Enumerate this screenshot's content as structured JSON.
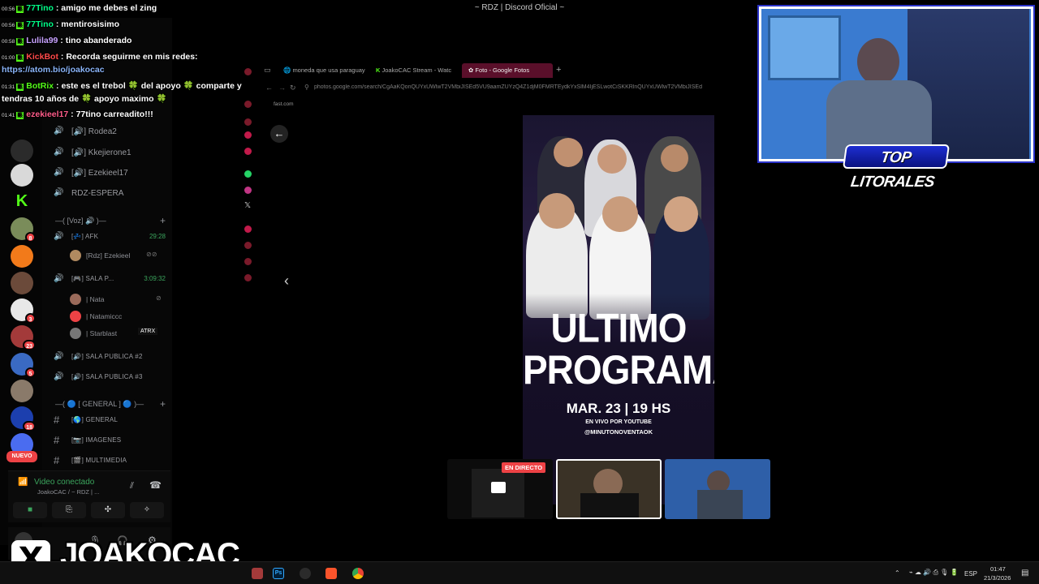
{
  "window": {
    "title": "~ RDZ | Discord Oficial ~"
  },
  "chat": [
    {
      "time": "00:56",
      "user": "77Tino",
      "color": "#00ff88",
      "sep": " : ",
      "text": "amigo me debes el zing"
    },
    {
      "time": "00:56",
      "user": "77Tino",
      "color": "#00ff88",
      "sep": " : ",
      "text": "mentirosisimo"
    },
    {
      "time": "00:58",
      "user": "Lulila99",
      "color": "#c8a2ff",
      "sep": " : ",
      "text": "tino abanderado"
    },
    {
      "time": "01:00",
      "user": "KickBot",
      "color": "#ff4a4a",
      "sep": " : ",
      "text": "Recorda seguirme en mis redes:"
    },
    {
      "time": "",
      "user": "",
      "color": "#ffffff",
      "sep": "",
      "text": "https://atom.bio/joakocac",
      "link": true
    },
    {
      "time": "01:31",
      "user": "BotRix",
      "color": "#53fc18",
      "sep": " : ",
      "text": "este es el trebol 🍀 del apoyo 🍀 comparte y"
    },
    {
      "time": "",
      "user": "",
      "color": "#ffffff",
      "sep": "",
      "text": "tendras 10 años de 🍀 apoyo maximo 🍀"
    },
    {
      "time": "01:41",
      "user": "ezekieel17",
      "color": "#ff5c8a",
      "sep": " : ",
      "text": "77tino carreadito!!!"
    }
  ],
  "channels": {
    "text_top": [
      {
        "icon": "🔊",
        "name": "Rodea2"
      },
      {
        "icon": "🔊",
        "name": "Kkejierone1"
      },
      {
        "icon": "🔊",
        "name": "Ezekieel17"
      },
      {
        "icon": "🔊",
        "name": "RDZ-ESPERA"
      }
    ],
    "voz_category": "[Voz]",
    "afk": {
      "name": "AFK",
      "time": "29:28",
      "user": "[Rdz] Ezekieel"
    },
    "sala_p": {
      "name": "SALA P...",
      "time": "3:09:32",
      "users": [
        "| Nata",
        "| Natamiccc",
        "| Starblast"
      ],
      "tag": "ATRX"
    },
    "publicas": [
      "SALA PUBLICA #2",
      "SALA PUBLICA #3"
    ],
    "general_category": "[ GENERAL ]",
    "text_channels": [
      "GENERAL",
      "IMAGENES",
      "MULTIMEDIA"
    ]
  },
  "server_badges": [
    "8",
    "3",
    "23",
    "5",
    "18"
  ],
  "nuevo_label": "NUEVO",
  "voice_panel": {
    "status": "Video conectado",
    "sub": "JoakoCAC / ~ RDZ | ..."
  },
  "browser": {
    "tabs": [
      "moneda que usa paraguay",
      "JoakoCAC Stream - Watc",
      "Foto - Google Fotos"
    ],
    "url": "photos.google.com/search/CgAaKQonQUYxUWlwT2VMbiJISEd5VU9aamZUYzQ4Z1djM0FMRTEydkYxSlM4IjESLwotCiSKKRlnQUYxUWlwT2VMbiJISEd",
    "bookmark": "fast.com"
  },
  "poster": {
    "title_1": "ULTIMO",
    "title_2": "PROGRAMA",
    "date": "MAR. 23 | 19 HS",
    "sub": "EN VIVO POR YOUTUBE",
    "handle": "@MINUTONOVENTAOK"
  },
  "live_badge": "EN DIRECTO",
  "webcam_logo": "TOP LITORALES",
  "brand": {
    "x": "X",
    "name": "JOAKOCAC"
  },
  "taskbar": {
    "lang": "ESP",
    "time": "01:47",
    "date": "21/3/2026"
  },
  "colors": {
    "discord_green": "#3ba55d",
    "kick_green": "#53fc18",
    "live_red": "#ed4245"
  }
}
